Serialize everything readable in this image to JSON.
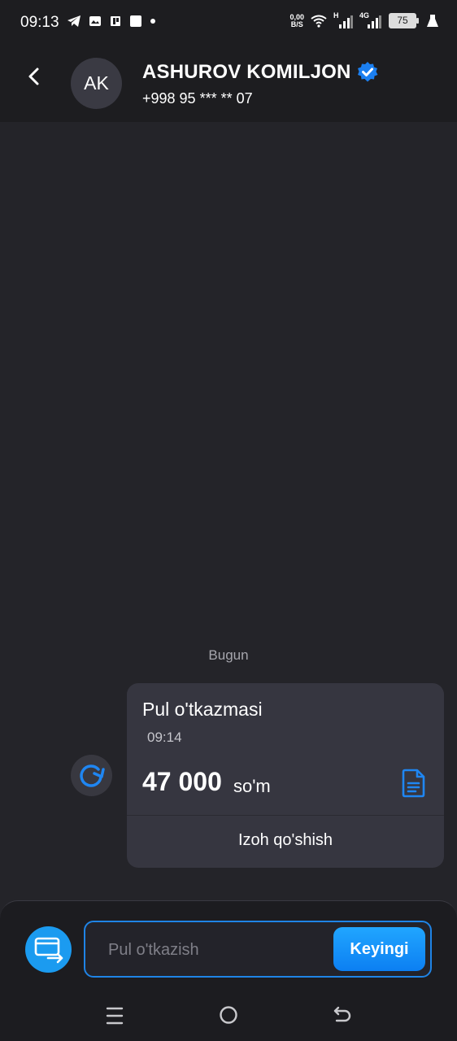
{
  "status_bar": {
    "time": "09:13",
    "net_speed_value": "0,00",
    "net_speed_unit": "B/S",
    "signal_1": "H",
    "signal_2": "4G",
    "battery": "75",
    "icons_left": [
      "telegram-icon",
      "gallery-icon",
      "pdf-icon",
      "square-icon",
      "dot-icon"
    ],
    "icons_right": [
      "wifi-icon",
      "signal-icon",
      "signal-icon",
      "battery-icon",
      "flask-icon"
    ]
  },
  "header": {
    "avatar_initials": "AK",
    "contact_name": "ASHUROV KOMILJON",
    "contact_phone": "+998 95 *** ** 07",
    "verified_icon": "verified-badge-icon"
  },
  "chat": {
    "date_separator": "Bugun",
    "message": {
      "title": "Pul o'tkazmasi",
      "time": "09:14",
      "amount": "47 000",
      "currency": "so'm",
      "action": "Izoh qo'shish"
    }
  },
  "composer": {
    "placeholder": "Pul o'tkazish",
    "value": "",
    "next_label": "Keyingi"
  },
  "colors": {
    "background": "#242429",
    "header": "#1d1d20",
    "bubble": "#363640",
    "accent": "#1b9bf0",
    "accent_dark": "#0c7ff2"
  }
}
